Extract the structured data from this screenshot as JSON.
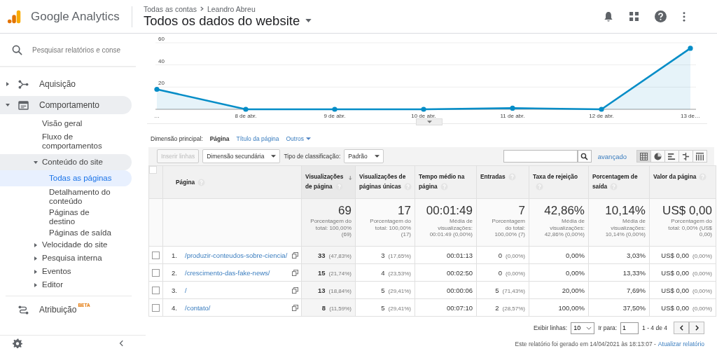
{
  "header": {
    "product": "Google Analytics",
    "breadcrumb": [
      "Todas as contas",
      "Leandro Abreu"
    ],
    "view_title": "Todos os dados do website"
  },
  "sidebar": {
    "search": {
      "placeholder": "Pesquisar relatórios e conse"
    },
    "items": [
      {
        "label": "Aquisição",
        "expanded": false,
        "selected": false
      },
      {
        "label": "Comportamento",
        "expanded": true,
        "selected": false,
        "children": [
          {
            "label": "Visão geral",
            "selected": false
          },
          {
            "label": "Fluxo de comportamentos",
            "selected": false
          },
          {
            "label": "Conteúdo do site",
            "expanded": true,
            "selected": false,
            "children": [
              {
                "label": "Todas as páginas",
                "selected": true
              },
              {
                "label": "Detalhamento do conteúdo",
                "selected": false
              },
              {
                "label": "Páginas de destino",
                "selected": false
              },
              {
                "label": "Páginas de saída",
                "selected": false
              }
            ]
          },
          {
            "label": "Velocidade do site",
            "expanded": false,
            "selected": false
          },
          {
            "label": "Pesquisa interna",
            "expanded": false,
            "selected": false
          },
          {
            "label": "Eventos",
            "expanded": false,
            "selected": false
          },
          {
            "label": "Editor",
            "expanded": false,
            "selected": false
          }
        ]
      },
      {
        "label": "Atribuição",
        "badge": "BETA",
        "selected": false
      }
    ]
  },
  "chart": {
    "chart_data": {
      "type": "line",
      "categories": [
        "…",
        "8 de abr.",
        "9 de abr.",
        "10 de abr.",
        "11 de abr.",
        "12 de abr.",
        "13 de…"
      ],
      "series": [
        {
          "color": "#058dc7",
          "marker": true,
          "values": [
            18,
            0,
            0,
            0,
            1,
            0,
            55
          ]
        }
      ],
      "ylim": [
        0,
        60
      ],
      "yticks": [
        20,
        40,
        60
      ]
    }
  },
  "dimension": {
    "label": "Dimensão principal:",
    "tabs": [
      {
        "label": "Página",
        "selected": true
      },
      {
        "label": "Título da página",
        "selected": false
      },
      {
        "label": "Outros",
        "selected": false
      }
    ]
  },
  "toolbar": {
    "insert_button": {
      "label": "Inserir linhas",
      "disabled": true
    },
    "secondary_dimension": "Dimensão secundária",
    "sort_label": "Tipo de classificação:",
    "sort_value": "Padrão",
    "advanced": "avançado",
    "views": [
      {
        "selected": true
      },
      {
        "selected": false
      },
      {
        "selected": false
      },
      {
        "selected": false
      },
      {
        "selected": false
      }
    ]
  },
  "table": {
    "header_checked": false,
    "columns": [
      {
        "label": "Página",
        "sorted": false
      },
      {
        "label": "Visualizações de página",
        "sorted": true
      },
      {
        "label": "Visualizações de páginas únicas",
        "sorted": false
      },
      {
        "label": "Tempo médio na página",
        "sorted": false
      },
      {
        "label": "Entradas",
        "sorted": false
      },
      {
        "label": "Taxa de rejeição",
        "sorted": false
      },
      {
        "label": "Porcentagem de saída",
        "sorted": false
      },
      {
        "label": "Valor da página",
        "sorted": false
      }
    ],
    "totals": [
      {
        "value": "69",
        "note": "Porcentagem do total: 100,00% (69)"
      },
      {
        "value": "17",
        "note": "Porcentagem do total: 100,00% (17)"
      },
      {
        "value": "00:01:49",
        "note": "Média de visualizações: 00:01:49 (0,00%)"
      },
      {
        "value": "7",
        "note": "Porcentagem do total: 100,00% (7)"
      },
      {
        "value": "42,86%",
        "note": "Média de visualizações: 42,86% (0,00%)"
      },
      {
        "value": "10,14%",
        "note": "Média de visualizações: 10,14% (0,00%)"
      },
      {
        "value": "US$ 0,00",
        "note": "Porcentagem do total: 0,00% (US$ 0,00)"
      }
    ],
    "rows": [
      {
        "checked": false,
        "index": "1.",
        "page": "/produzir-conteudos-sobre-ciencia/",
        "views": "33",
        "views_share": "(47,83%)",
        "unique": "3",
        "unique_share": "(17,65%)",
        "time": "00:01:13",
        "entries": "0",
        "entries_share": "(0,00%)",
        "bounce": "0,00%",
        "exit": "3,03%",
        "value": "US$ 0,00",
        "value_share": "(0,00%)"
      },
      {
        "checked": false,
        "index": "2.",
        "page": "/crescimento-das-fake-news/",
        "views": "15",
        "views_share": "(21,74%)",
        "unique": "4",
        "unique_share": "(23,53%)",
        "time": "00:02:50",
        "entries": "0",
        "entries_share": "(0,00%)",
        "bounce": "0,00%",
        "exit": "13,33%",
        "value": "US$ 0,00",
        "value_share": "(0,00%)"
      },
      {
        "checked": false,
        "index": "3.",
        "page": "/",
        "views": "13",
        "views_share": "(18,84%)",
        "unique": "5",
        "unique_share": "(29,41%)",
        "time": "00:00:06",
        "entries": "5",
        "entries_share": "(71,43%)",
        "bounce": "20,00%",
        "exit": "7,69%",
        "value": "US$ 0,00",
        "value_share": "(0,00%)"
      },
      {
        "checked": false,
        "index": "4.",
        "page": "/contato/",
        "views": "8",
        "views_share": "(11,59%)",
        "unique": "5",
        "unique_share": "(29,41%)",
        "time": "00:07:10",
        "entries": "2",
        "entries_share": "(28,57%)",
        "bounce": "100,00%",
        "exit": "37,50%",
        "value": "US$ 0,00",
        "value_share": "(0,00%)"
      }
    ]
  },
  "pagination": {
    "rows_label": "Exibir linhas:",
    "rows_value": "10",
    "goto_label": "Ir para:",
    "goto_value": "1",
    "range": "1 - 4 de 4"
  },
  "footer": {
    "note": "Este relatório foi gerado em 14/04/2021 às 18:13:07 -",
    "link": "Atualizar relatório"
  }
}
